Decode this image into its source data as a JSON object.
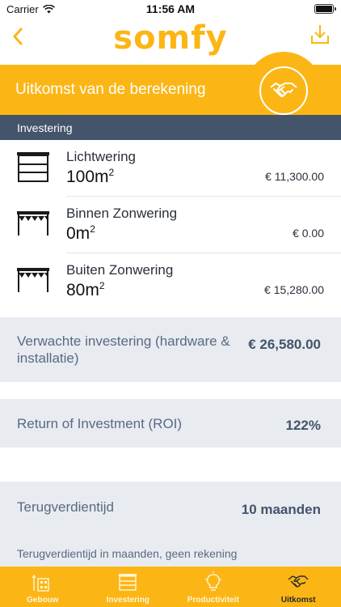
{
  "status_bar": {
    "carrier": "Carrier",
    "time": "11:56 AM"
  },
  "nav": {
    "logo": "somfy",
    "back_icon": "chevron-left-icon",
    "download_icon": "download-icon"
  },
  "header": {
    "title": "Uitkomst van de berekening",
    "icon": "handshake-icon"
  },
  "section": {
    "title": "Investering"
  },
  "products": [
    {
      "name": "Lichtwering",
      "area": "100m",
      "unit_exp": "2",
      "price": "€ 11,300.00",
      "icon": "blinds-icon"
    },
    {
      "name": "Binnen Zonwering",
      "area": "0m",
      "unit_exp": "2",
      "price": "€ 0.00",
      "icon": "awning-icon"
    },
    {
      "name": "Buiten Zonwering",
      "area": "80m",
      "unit_exp": "2",
      "price": "€ 15,280.00",
      "icon": "awning-icon"
    }
  ],
  "summary": {
    "investment_label": "Verwachte investering (hardware & installatie)",
    "investment_value": "€ 26,580.00",
    "roi_label": "Return of Investment (ROI)",
    "roi_value": "122%",
    "payback_label": "Terugverdientijd",
    "payback_value": "10 maanden",
    "payback_note": "Terugverdientijd in maanden, geen rekening"
  },
  "tabs": [
    {
      "label": "Gebouw",
      "icon": "building-icon",
      "active": false
    },
    {
      "label": "Investering",
      "icon": "blinds-icon",
      "active": false
    },
    {
      "label": "Productiviteit",
      "icon": "lightbulb-icon",
      "active": false
    },
    {
      "label": "Uitkomst",
      "icon": "handshake-icon",
      "active": true
    }
  ],
  "colors": {
    "brand_yellow": "#fbb616",
    "section_navy": "#44546a",
    "band_gray": "#e8ebf0"
  }
}
